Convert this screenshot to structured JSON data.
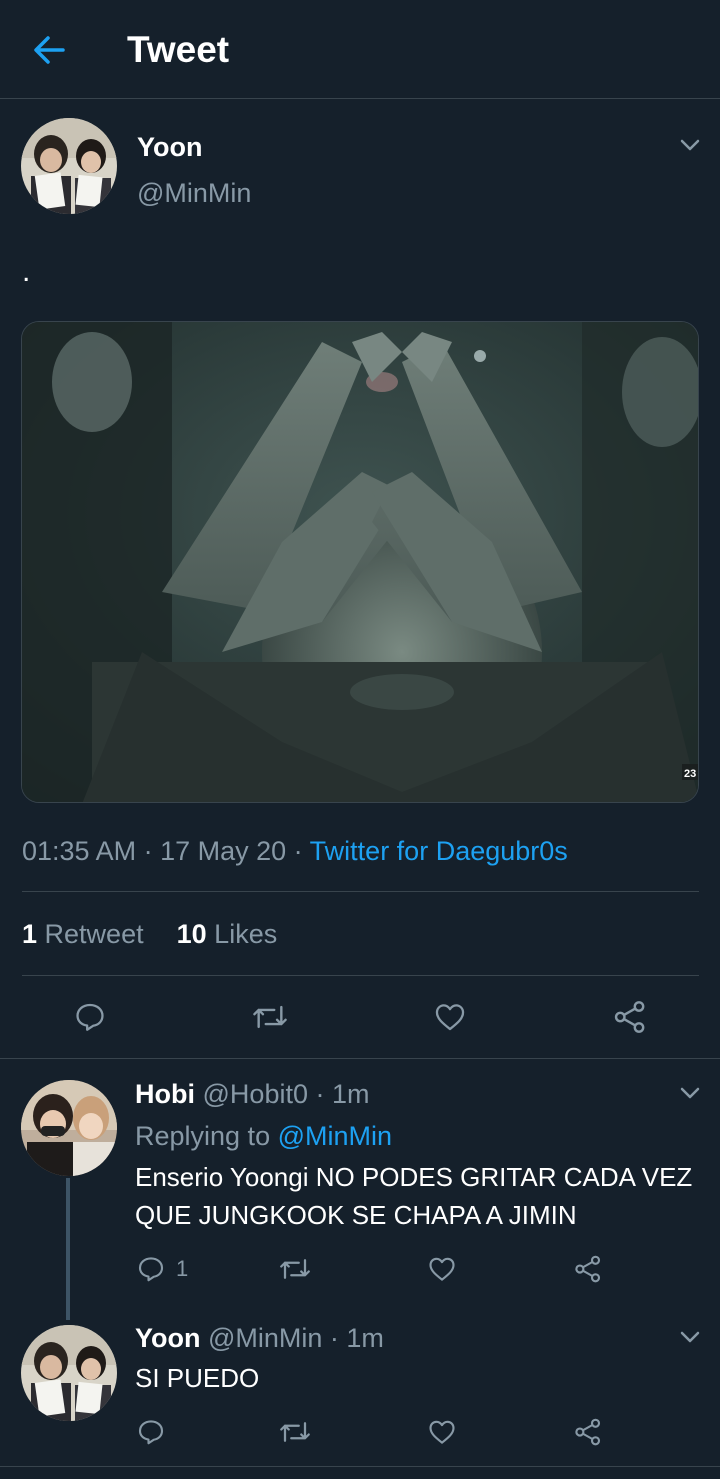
{
  "header": {
    "title": "Tweet",
    "back_icon": "arrow-left-icon",
    "accent": "#1da1f2"
  },
  "tweet": {
    "author_name": "Yoon",
    "author_handle": "@MinMin",
    "text": ".",
    "time": "01:35 AM",
    "sep1": " · ",
    "date": "17 May 20",
    "sep2": " · ",
    "source": "Twitter for Daegubr0s",
    "retweets_count": "1",
    "retweets_label": " Retweet",
    "likes_count": "10",
    "likes_label": " Likes",
    "media_badge": "23"
  },
  "replies": [
    {
      "author_name": "Hobi",
      "author_handle": "@Hobit0",
      "time": " · 1m",
      "replying_prefix": "Replying to ",
      "replying_to": "@MinMin",
      "text": "Enserio Yoongi NO PODES GRITAR CADA VEZ QUE JUNGKOOK SE CHAPA A JIMIN",
      "reply_count": "1"
    },
    {
      "author_name": "Yoon",
      "author_handle": "@MinMin",
      "time": " · 1m",
      "text": "SI PUEDO"
    }
  ],
  "colors": {
    "background": "#15202b",
    "border": "#38444d",
    "muted": "#8899a6",
    "link": "#1da1f2"
  }
}
